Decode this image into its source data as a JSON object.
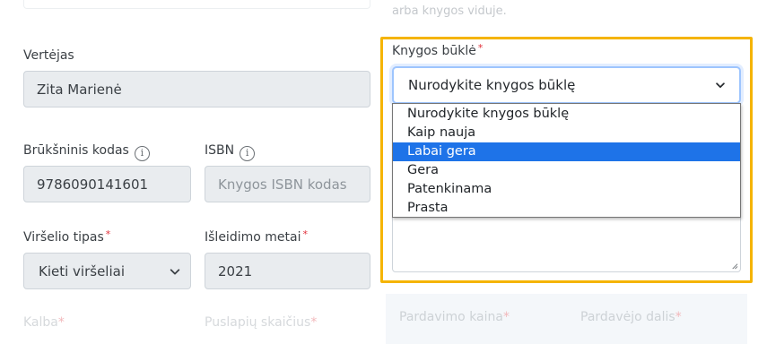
{
  "top": {
    "faded_hint": "arba knygos viduje."
  },
  "translator": {
    "label": "Vertėjas",
    "value": "Zita Marienė"
  },
  "barcode": {
    "label": "Brūkšninis kodas",
    "info_icon": "info-circle-icon",
    "value": "9786090141601"
  },
  "isbn": {
    "label": "ISBN",
    "info_icon": "info-circle-icon",
    "placeholder": "Knygos ISBN kodas"
  },
  "cover_type": {
    "label": "Viršelio tipas",
    "required_mark": "*",
    "value": "Kieti viršeliai"
  },
  "release_year": {
    "label": "Išleidimo metai",
    "required_mark": "*",
    "value": "2021"
  },
  "faded_bottom": {
    "left_label": "Kalba",
    "left_required": "*",
    "right_label": "Puslapių skaičius",
    "right_required": "*"
  },
  "condition": {
    "label": "Knygos būklė",
    "required_mark": "*",
    "selected": "Nurodykite knygos būklę",
    "options": [
      "Nurodykite knygos būklę",
      "Kaip nauja",
      "Labai gera",
      "Gera",
      "Patenkinama",
      "Prasta"
    ],
    "highlighted_option": "Labai gera"
  },
  "price": {
    "sale_label": "Pardavimo kaina",
    "sale_required": "*",
    "seller_label": "Pardavėjo dalis",
    "seller_required": "*"
  },
  "colors": {
    "highlight_frame": "#f5b400",
    "selected_option": "#1e73e8",
    "required": "#e0303a"
  }
}
